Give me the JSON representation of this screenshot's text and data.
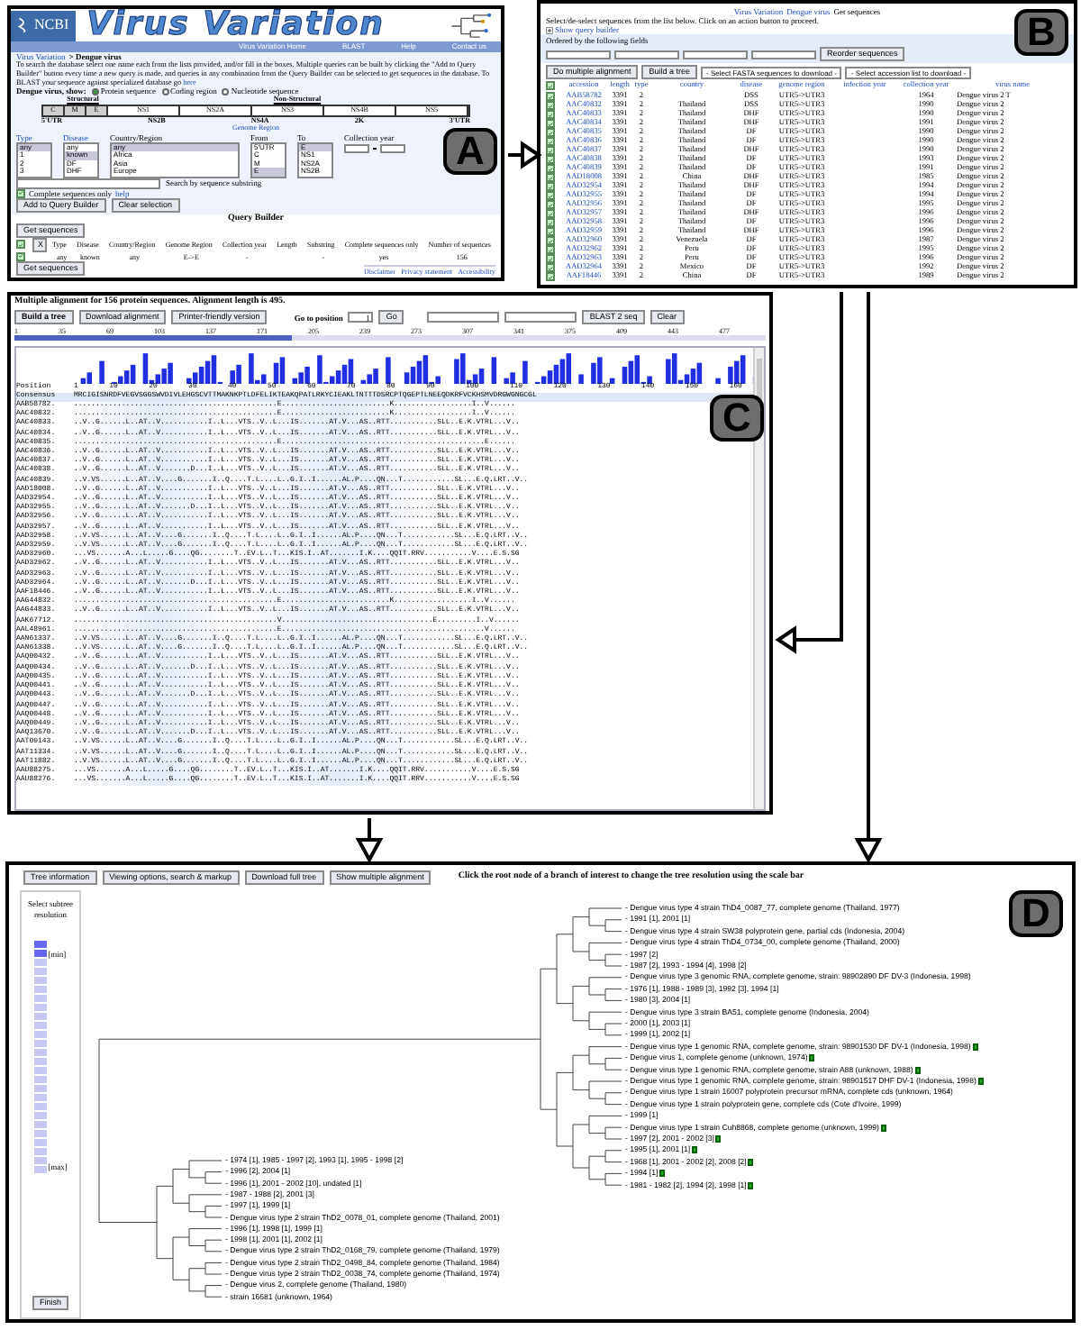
{
  "panels": {
    "a": "A",
    "b": "B",
    "c": "C",
    "d": "D"
  },
  "search_page": {
    "logo_text": "NCBI",
    "title": "Virus Variation",
    "nav": [
      "Virus Variation Home",
      "BLAST",
      "Help",
      "Contact us"
    ],
    "breadcrumb_link": "Virus Variation",
    "breadcrumb_rest": "> Dengue virus",
    "intro": "To search the database select one name each from the lists provided, and/or fill in the boxes. Multiple queries can be built by clicking the \"Add to Query Builder\" button every time a new query is made, and queries in any combination from the Query Builder can be selected to get sequences in the database. To BLAST your sequence against specialized database go",
    "intro_link": "here",
    "show_label": "Dengue virus, show:",
    "views": [
      {
        "label": "Protein sequence",
        "selected": true
      },
      {
        "label": "Coding region",
        "selected": false
      },
      {
        "label": "Nucleotide sequence",
        "selected": false
      }
    ],
    "genome": {
      "structural": "Structural",
      "nonstructural": "Non-Structural",
      "segments": [
        {
          "label": "C",
          "kind": "structural"
        },
        {
          "label": "M",
          "kind": "structural"
        },
        {
          "label": "E",
          "kind": "structural"
        },
        {
          "label": "NS1",
          "kind": "nonstructural"
        },
        {
          "label": "NS2A",
          "kind": "nonstructural"
        },
        {
          "label": "NS3",
          "kind": "nonstructural"
        },
        {
          "label": "NS4B",
          "kind": "nonstructural"
        },
        {
          "label": "NS5",
          "kind": "nonstructural"
        }
      ],
      "markers": [
        "5'UTR",
        "NS2B",
        "NS4A",
        "2K",
        "3'UTR"
      ],
      "region_link": "Genome Region"
    },
    "filters": [
      {
        "label": "Type",
        "link": true,
        "options": [
          {
            "text": "any",
            "selected": true
          },
          {
            "text": "1",
            "selected": false
          },
          {
            "text": "2",
            "selected": false
          },
          {
            "text": "3",
            "selected": false
          }
        ]
      },
      {
        "label": "Disease",
        "link": true,
        "options": [
          {
            "text": "any",
            "selected": false
          },
          {
            "text": "known",
            "selected": true
          },
          {
            "text": "DF",
            "selected": false
          },
          {
            "text": "DHF",
            "selected": false
          }
        ]
      },
      {
        "label": "Country/Region",
        "link": false,
        "options": [
          {
            "text": "any",
            "selected": true
          },
          {
            "text": "Africa",
            "selected": false
          },
          {
            "text": "Asia",
            "selected": false
          },
          {
            "text": "Europe",
            "selected": false
          }
        ]
      },
      {
        "label": "From",
        "link": false,
        "options": [
          {
            "text": "5'UTR",
            "selected": false
          },
          {
            "text": "C",
            "selected": false
          },
          {
            "text": "M",
            "selected": false
          },
          {
            "text": "E",
            "selected": true
          }
        ]
      },
      {
        "label": "To",
        "link": false,
        "options": [
          {
            "text": "E",
            "selected": true
          },
          {
            "text": "NS1",
            "selected": false
          },
          {
            "text": "NS2A",
            "selected": false
          },
          {
            "text": "NS2B",
            "selected": false
          }
        ]
      }
    ],
    "collection_year_label": "Collection year",
    "substring_label": "Search by sequence substring",
    "complete_only": {
      "label": "Complete sequences only",
      "checked": true
    },
    "help_link": "help",
    "buttons": [
      "Add to Query Builder",
      "Clear selection"
    ],
    "query_builder": {
      "title": "Query Builder",
      "get_buttons": [
        "Get sequences",
        "Get sequences"
      ],
      "header_checked": true,
      "remove_button": "X",
      "columns": [
        "Type",
        "Disease",
        "Country/Region",
        "Genome Region",
        "Collection year",
        "Length",
        "Substring",
        "Complete sequences only",
        "Number of sequences"
      ],
      "row": {
        "checked": true,
        "cells": [
          "any",
          "known",
          "any",
          "E->E",
          "-",
          "",
          "-",
          "yes",
          "156"
        ]
      }
    },
    "footer_links": [
      "Disclaimer",
      "Privacy statement",
      "Accessibility"
    ]
  },
  "sequence_list": {
    "breadcrumb_links": [
      "Virus Variation",
      "Dengue virus"
    ],
    "breadcrumb_current": "Get sequences",
    "instruction": "Select/de-select sequences from the list below.  Click on an action button to proceed.",
    "show_query_builder": "Show query builder",
    "order_label": "Ordered by the following fields",
    "reorder_button": "Reorder sequences",
    "actions": [
      "Do multiple alignment",
      "Build a tree"
    ],
    "downloads": [
      "- Select FASTA sequences to download -",
      "- Select accession list to download -"
    ],
    "header_checked": true,
    "columns": [
      "accession",
      "length",
      "type",
      "country",
      "disease",
      "genome region",
      "infection year",
      "collection year",
      "virus name"
    ],
    "rows": [
      {
        "checked": true,
        "accession": "AAB58782",
        "length": "3391",
        "type": "2",
        "country": "",
        "disease": "DSS",
        "region": "UTR5->UTR3",
        "year": "1964",
        "virus": "Dengue virus 2 T"
      },
      {
        "checked": true,
        "accession": "AAC40832",
        "length": "3391",
        "type": "2",
        "country": "Thailand",
        "disease": "DSS",
        "region": "UTR5->UTR3",
        "year": "1990",
        "virus": "Dengue virus 2"
      },
      {
        "checked": true,
        "accession": "AAC40833",
        "length": "3391",
        "type": "2",
        "country": "Thailand",
        "disease": "DHF",
        "region": "UTR5->UTR3",
        "year": "1990",
        "virus": "Dengue virus 2"
      },
      {
        "checked": true,
        "accession": "AAC40834",
        "length": "3391",
        "type": "2",
        "country": "Thailand",
        "disease": "DHF",
        "region": "UTR5->UTR3",
        "year": "1991",
        "virus": "Dengue virus 2"
      },
      {
        "checked": true,
        "accession": "AAC40835",
        "length": "3391",
        "type": "2",
        "country": "Thailand",
        "disease": "DF",
        "region": "UTR5->UTR3",
        "year": "1990",
        "virus": "Dengue virus 2"
      },
      {
        "checked": true,
        "accession": "AAC40836",
        "length": "3391",
        "type": "2",
        "country": "Thailand",
        "disease": "DF",
        "region": "UTR5->UTR3",
        "year": "1990",
        "virus": "Dengue virus 2"
      },
      {
        "checked": true,
        "accession": "AAC40837",
        "length": "3391",
        "type": "2",
        "country": "Thailand",
        "disease": "DHF",
        "region": "UTR5->UTR3",
        "year": "1990",
        "virus": "Dengue virus 2"
      },
      {
        "checked": true,
        "accession": "AAC40838",
        "length": "3391",
        "type": "2",
        "country": "Thailand",
        "disease": "DF",
        "region": "UTR5->UTR3",
        "year": "1993",
        "virus": "Dengue virus 2"
      },
      {
        "checked": true,
        "accession": "AAC40839",
        "length": "3391",
        "type": "2",
        "country": "Thailand",
        "disease": "DF",
        "region": "UTR5->UTR3",
        "year": "1991",
        "virus": "Dengue virus 2"
      },
      {
        "checked": true,
        "accession": "AAD18008",
        "length": "3391",
        "type": "2",
        "country": "China",
        "disease": "DHF",
        "region": "UTR5->UTR3",
        "year": "1985",
        "virus": "Dengue virus 2"
      },
      {
        "checked": true,
        "accession": "AAD32954",
        "length": "3391",
        "type": "2",
        "country": "Thailand",
        "disease": "DHF",
        "region": "UTR5->UTR3",
        "year": "1994",
        "virus": "Dengue virus 2"
      },
      {
        "checked": true,
        "accession": "AAD32955",
        "length": "3391",
        "type": "2",
        "country": "Thailand",
        "disease": "DF",
        "region": "UTR5->UTR3",
        "year": "1994",
        "virus": "Dengue virus 2"
      },
      {
        "checked": true,
        "accession": "AAD32956",
        "length": "3391",
        "type": "2",
        "country": "Thailand",
        "disease": "DF",
        "region": "UTR5->UTR3",
        "year": "1995",
        "virus": "Dengue virus 2"
      },
      {
        "checked": true,
        "accession": "AAD32957",
        "length": "3391",
        "type": "2",
        "country": "Thailand",
        "disease": "DHF",
        "region": "UTR5->UTR3",
        "year": "1996",
        "virus": "Dengue virus 2"
      },
      {
        "checked": true,
        "accession": "AAD32958",
        "length": "3391",
        "type": "2",
        "country": "Thailand",
        "disease": "DF",
        "region": "UTR5->UTR3",
        "year": "1996",
        "virus": "Dengue virus 2"
      },
      {
        "checked": true,
        "accession": "AAD32959",
        "length": "3391",
        "type": "2",
        "country": "Thailand",
        "disease": "DHF",
        "region": "UTR5->UTR3",
        "year": "1996",
        "virus": "Dengue virus 2"
      },
      {
        "checked": true,
        "accession": "AAD32960",
        "length": "3391",
        "type": "2",
        "country": "Venezuela",
        "disease": "DF",
        "region": "UTR5->UTR3",
        "year": "1987",
        "virus": "Dengue virus 2"
      },
      {
        "checked": true,
        "accession": "AAD32962",
        "length": "3391",
        "type": "2",
        "country": "Peru",
        "disease": "DF",
        "region": "UTR5->UTR3",
        "year": "1995",
        "virus": "Dengue virus 2"
      },
      {
        "checked": true,
        "accession": "AAD32963",
        "length": "3391",
        "type": "2",
        "country": "Peru",
        "disease": "DF",
        "region": "UTR5->UTR3",
        "year": "1996",
        "virus": "Dengue virus 2"
      },
      {
        "checked": true,
        "accession": "AAD32964",
        "length": "3391",
        "type": "2",
        "country": "Mexico",
        "disease": "DF",
        "region": "UTR5->UTR3",
        "year": "1992",
        "virus": "Dengue virus 2"
      },
      {
        "checked": true,
        "accession": "AAF18446",
        "length": "3391",
        "type": "2",
        "country": "China",
        "disease": "DF",
        "region": "UTR5->UTR3",
        "year": "1989",
        "virus": "Dengue virus 2"
      }
    ]
  },
  "alignment": {
    "title": "Multiple alignment for 156 protein sequences. Alignment length is 495.",
    "buttons": [
      "Build a tree",
      "Download alignment",
      "Printer-friendly version"
    ],
    "goto_label": "Go to position",
    "goto_value": "1",
    "go": "Go",
    "blast": "BLAST 2 seq",
    "clear": "Clear",
    "ruler": [
      "1",
      "35",
      "69",
      "103",
      "137",
      "171",
      "205",
      "239",
      "273",
      "307",
      "341",
      "375",
      "409",
      "443",
      "477"
    ],
    "position_label": "Position",
    "positions": [
      "1",
      "10",
      "20",
      "30",
      "40",
      "50",
      "60",
      "70",
      "80",
      "90",
      "100",
      "110",
      "120",
      "130",
      "140",
      "150",
      "160"
    ],
    "consensus_label": "Consensus",
    "consensus": "MRCIGISNRDFVEGVSGGSWVDIVLEHGSCVTTMAKNKPTLDFELIKTEAKQPATLRKYCIEAKLTNTTTDSRCPTQGEPTLNEEQDKRFVCKHSMVDRGWGNGCGL",
    "rows": [
      {
        "name": "AAB58782.",
        "seq": "...............................................E.........................K..................I..V......"
      },
      {
        "name": "AAC40832.",
        "seq": "...............................................E.........................K..................I..V......"
      },
      {
        "name": "AAC40833.",
        "seq": "..V..G......L..AT..V...........I..L...VTS..V..L...IS.......AT.V...AS..RTT...........SLL..E.K.VTRL...V.."
      },
      {
        "name": "AAC40834.",
        "seq": "..V..G......L..AT..V...........I..L...VTS..V..L...IS.......AT.V...AS..RTT...........SLL..E.K.VTRL...V.."
      },
      {
        "name": "AAC40835.",
        "seq": "...............................................E...............................................E......"
      },
      {
        "name": "AAC40836.",
        "seq": "..V..G......L..AT..V...........I..L...VTS..V..L...IS.......AT.V...AS..RTT...........SLL..E.K.VTRL...V.."
      },
      {
        "name": "AAC40837.",
        "seq": "..V..G......L..AT..V...........I..L...VTS..V..L...IS.......AT.V...AS..RTT...........SLL..E.K.VTRL...V.."
      },
      {
        "name": "AAC40838.",
        "seq": "..V..G......L..AT..V.......D...I..L...VTS..V..L...IS.......AT.V...AS..RTT...........SLL..E.K.VTRL...V.."
      },
      {
        "name": "AAC40839.",
        "seq": "..V.VS......L..AT..V....G.......I..Q....T.L....L..G.I..I......AL.P....QN...T............SL...E.Q.LRT..V.."
      },
      {
        "name": "AAD18008.",
        "seq": "..V..G......L..AT..V...........I..L...VTS..V..L...IS.......AT.V...AS..RTT...........SLL..E.K.VTRL...V.."
      },
      {
        "name": "AAD32954.",
        "seq": "..V..G......L..AT..V...........I..L...VTS..V..L...IS.......AT.V...AS..RTT...........SLL..E.K.VTRL...V.."
      },
      {
        "name": "AAD32955.",
        "seq": "..V..G......L..AT..V.......D...I..L...VTS..V..L...IS.......AT.V...AS..RTT...........SLL..E.K.VTRL...V.."
      },
      {
        "name": "AAD32956.",
        "seq": "..V..G......L..AT..V...........I..L...VTS..V..L...IS.......AT.V...AS..RTT...........SLL..E.K.VTRL...V.."
      },
      {
        "name": "AAD32957.",
        "seq": "..V..G......L..AT..V...........I..L...VTS..V..L...IS.......AT.V...AS..RTT...........SLL..E.K.VTRL...V.."
      },
      {
        "name": "AAD32958.",
        "seq": "..V.VS......L..AT..V....G.......I..Q....T.L....L..G.I..I......AL.P....QN...T............SL...E.Q.LRT..V.."
      },
      {
        "name": "AAD32959.",
        "seq": "..V.VS......L..AT..V....G.......I..Q....T.L....L..G.I..I......AL.P....QN...T............SL...E.Q.LRT..V.."
      },
      {
        "name": "AAD32960.",
        "seq": "...VS.......A...L.....G....QG........T..EV.L..T...KIS.I..AT.......I.K....QQIT.RRV...........V....E.S.SG"
      },
      {
        "name": "AAD32962.",
        "seq": "..V..G......L..AT..V...........I..L...VTS..V..L...IS.......AT.V...AS..RTT...........SLL..E.K.VTRL...V.."
      },
      {
        "name": "AAD32963.",
        "seq": "..V..G......L..AT..V...........I..L...VTS..V..L...IS.......AT.V...AS..RTT...........SLL..E.K.VTRL...V.."
      },
      {
        "name": "AAD32964.",
        "seq": "..V..G......L..AT..V.......D...I..L...VTS..V..L...IS.......AT.V...AS..RTT...........SLL..E.K.VTRL...V.."
      },
      {
        "name": "AAF18446.",
        "seq": "..V..G......L..AT..V...........I..L...VTS..V..L...IS.......AT.V...AS..RTT...........SLL..E.K.VTRL...V.."
      },
      {
        "name": "AAG44832.",
        "seq": "...............................................E.........................K..................I..V......"
      },
      {
        "name": "AAG44833.",
        "seq": "..V..G......L..AT..V...........I..L...VTS..V..L...IS.......AT.V...AS..RTT...........SLL..E.K.VTRL...V.."
      },
      {
        "name": "AAK67712.",
        "seq": "...............................................V...................................E.........I..V......"
      },
      {
        "name": "AAL48961.",
        "seq": "...............................................E...............................................V......"
      },
      {
        "name": "AAN61337.",
        "seq": "..V.VS......L..AT..V....G.......I..Q....T.L....L..G.I..I......AL.P....QN...T............SL...E.Q.LRT..V.."
      },
      {
        "name": "AAN61338.",
        "seq": "..V.VS......L..AT..V....G.......I..Q....T.L....L..G.I..I......AL.P....QN...T............SL...E.Q.LRT..V.."
      },
      {
        "name": "AAQ00432.",
        "seq": "..V..G......L..AT..V...........I..L...VTS..V..L...IS.......AT.V...AS..RTT...........SLL..E.K.VTRL...V.."
      },
      {
        "name": "AAQ00434.",
        "seq": "..V..G......L..AT..V.......D...I..L...VTS..V..L...IS.......AT.V...AS..RTT...........SLL..E.K.VTRL...V.."
      },
      {
        "name": "AAQ00435.",
        "seq": "..V..G......L..AT..V...........I..L...VTS..V..L...IS.......AT.V...AS..RTT...........SLL..E.K.VTRL...V.."
      },
      {
        "name": "AAQ00441.",
        "seq": "..V..G......L..AT..V...........I..L...VTS..V..L...IS.......AT.V...AS..RTT...........SLL..E.K.VTRL...V.."
      },
      {
        "name": "AAQ00443.",
        "seq": "..V..G......L..AT..V.......D...I..L...VTS..V..L...IS.......AT.V...AS..RTT...........SLL..E.K.VTRL...V.."
      },
      {
        "name": "AAQ00447.",
        "seq": "..V..G......L..AT..V...........I..L...VTS..V..L...IS.......AT.V...AS..RTT...........SLL..E.K.VTRL...V.."
      },
      {
        "name": "AAQ00448.",
        "seq": "..V..G......L..AT..V...........I..L...VTS..V..L...IS.......AT.V...AS..RTT...........SLL..E.K.VTRL...V.."
      },
      {
        "name": "AAQ00449.",
        "seq": "..V..G......L..AT..V...........I..L...VTS..V..L...IS.......AT.V...AS..RTT...........SLL..E.K.VTRL...V.."
      },
      {
        "name": "AAQ13670.",
        "seq": "..V..G......L..AT..V.......D...I..L...VTS..V..L...IS.......AT.V...AS..RTT...........SLL..E.K.VTRL...V.."
      },
      {
        "name": "AAT09143.",
        "seq": "..V.VS......L..AT..V....G.......I..Q....T.L....L..G.I..I......AL.P....QN...T............SL...E.Q.LRT..V.."
      },
      {
        "name": "AAT11334.",
        "seq": "..V.VS......L..AT..V....G.......I..Q....T.L....L..G.I..I......AL.P....QN...T............SL...E.Q.LRT..V.."
      },
      {
        "name": "AAT11882.",
        "seq": "..V.VS......L..AT..V....G.......I..Q....T.L....L..G.I..I......AL.P....QN...T............SL...E.Q.LRT..V.."
      },
      {
        "name": "AAU88275.",
        "seq": "...VS.......A...L.....G....QG........T..EV.L..T...KIS.I..AT.......I.K....QQIT.RRV...........V....E.S.SG"
      },
      {
        "name": "AAU88276.",
        "seq": "...VS.......A...L.....G....QG........T..EV.L..T...KIS.I..AT.......I.K....QQIT.RRV...........V....E.S.SG"
      }
    ]
  },
  "tree_view": {
    "buttons": [
      "Tree information",
      "Viewing options, search & markup",
      "Download full tree",
      "Show multiple alignment"
    ],
    "hint": "Click the root node of a branch of interest to change the tree resolution using the scale bar",
    "scale_title": "Select subtree resolution",
    "scale_min": "[min]",
    "scale_max": "[max]",
    "finish": "Finish",
    "upper_labels": [
      {
        "text": "- Dengue virus type 4 strain ThD4_0087_77, complete genome (Thailand, 1977)",
        "flag": false
      },
      {
        "text": "- 1991 [1], 2001 [1]",
        "flag": false
      },
      {
        "text": "- Dengue virus type 4 strain SW38 polyprotein gene, partial cds (Indonesia, 2004)",
        "flag": false
      },
      {
        "text": "- Dengue virus type 4 strain ThD4_0734_00, complete genome (Thailand, 2000)",
        "flag": false
      },
      {
        "text": "- 1997 [2]",
        "flag": false
      },
      {
        "text": "- 1987 [2], 1993 - 1994 [4], 1998 [2]",
        "flag": false
      },
      {
        "text": "- Dengue virus type 3 genomic RNA, complete genome, strain: 98902890 DF DV-3 (Indonesia, 1998)",
        "flag": false
      },
      {
        "text": "- 1976 [1], 1988 - 1989 [3], 1992 [3], 1994 [1]",
        "flag": false
      },
      {
        "text": "- 1980 [3], 2004 [1]",
        "flag": false
      },
      {
        "text": "- Dengue virus type 3 strain BA51, complete genome (Indonesia, 2004)",
        "flag": false
      },
      {
        "text": "- 2000 [1], 2003 [1]",
        "flag": false
      },
      {
        "text": "- 1999 [1], 2002 [1]",
        "flag": false
      },
      {
        "text": "- Dengue virus type 1 genomic RNA, complete genome, strain: 98901530 DF DV-1 (Indonesia, 1998)",
        "flag": true
      },
      {
        "text": "- Dengue virus 1, complete genome (unknown, 1974)",
        "flag": true
      },
      {
        "text": "- Dengue virus type 1 genomic RNA, complete genome, strain A88 (unknown, 1988)",
        "flag": true
      },
      {
        "text": "- Dengue virus type 1 genomic RNA, complete genome, strain: 98901517 DHF DV-1 (Indonesia, 1998)",
        "flag": true
      },
      {
        "text": "- Dengue virus type 1 strain 16007 polyprotein precursor mRNA, complete cds (unknown, 1964)",
        "flag": false
      },
      {
        "text": "- Dengue virus type 1 strain polyprotein gene, complete cds (Cote d'Ivoire, 1999)",
        "flag": false
      },
      {
        "text": "- 1999 [1]",
        "flag": false
      },
      {
        "text": "- Dengue virus type 1 strain Cuh8868, complete genome (unknown, 1999)",
        "flag": true
      },
      {
        "text": "- 1997 [2], 2001 - 2002 [3]",
        "flag": true
      },
      {
        "text": "- 1995 [1], 2001 [1]",
        "flag": true
      },
      {
        "text": "- 1968 [1], 2001 - 2002 [2], 2008 [2]",
        "flag": true
      },
      {
        "text": "- 1994 [1]",
        "flag": true
      },
      {
        "text": "- 1981 - 1982 [2], 1994 [2], 1998 [1]",
        "flag": true
      }
    ],
    "lower_labels": [
      {
        "text": "- 1974 [1], 1985 - 1997 [2], 1993 [1], 1995 - 1998 [2]",
        "flag": false
      },
      {
        "text": "- 1996 [2], 2004 [1]",
        "flag": false
      },
      {
        "text": "- 1996 [1], 2001 - 2002 [10], undated [1]",
        "flag": false
      },
      {
        "text": "- 1987 - 1988 [2], 2001 [3]",
        "flag": false
      },
      {
        "text": "- 1997 [1], 1999 [1]",
        "flag": false
      },
      {
        "text": "- Dengue virus type 2 strain ThD2_0078_01, complete genome (Thailand, 2001)",
        "flag": false
      },
      {
        "text": "- 1996 [1], 1998 [1], 1999 [1]",
        "flag": false
      },
      {
        "text": "- 1998 [1], 2001 [1], 2002 [1]",
        "flag": false
      },
      {
        "text": "- Dengue virus type 2 strain ThD2_0168_79, complete genome (Thailand, 1979)",
        "flag": false
      },
      {
        "text": "- Dengue virus type 2 strain ThD2_0498_84, complete genome (Thailand, 1984)",
        "flag": false
      },
      {
        "text": "- Dengue virus type 2 strain ThD2_0038_74, complete genome (Thailand, 1974)",
        "flag": false
      },
      {
        "text": "- Dengue virus 2, complete genome (Thailand, 1980)",
        "flag": false
      },
      {
        "text": "- strain 16681 (unknown, 1964)",
        "flag": false
      }
    ]
  }
}
